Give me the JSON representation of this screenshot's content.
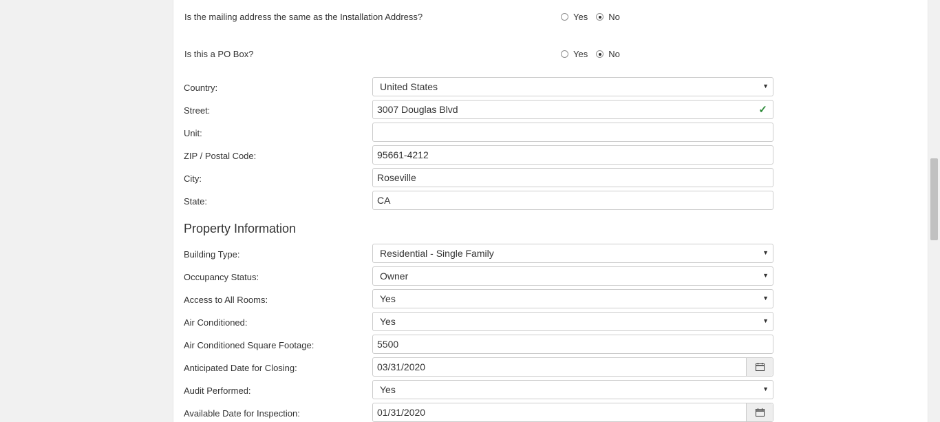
{
  "questions": [
    {
      "text": "Is the mailing address the same as the Installation Address?",
      "yes": "Yes",
      "no": "No",
      "selected": "No"
    },
    {
      "text": "Is this a PO Box?",
      "yes": "Yes",
      "no": "No",
      "selected": "No"
    }
  ],
  "mailing": {
    "country_label": "Country:",
    "country_value": "United States",
    "street_label": "Street:",
    "street_value": "3007 Douglas Blvd",
    "unit_label": "Unit:",
    "unit_value": "",
    "zip_label": "ZIP / Postal Code:",
    "zip_value": "95661-4212",
    "city_label": "City:",
    "city_value": "Roseville",
    "state_label": "State:",
    "state_value": "CA"
  },
  "property": {
    "title": "Property Information",
    "building_type_label": "Building Type:",
    "building_type_value": "Residential - Single Family",
    "occupancy_label": "Occupancy Status:",
    "occupancy_value": "Owner",
    "access_label": "Access to All Rooms:",
    "access_value": "Yes",
    "ac_label": "Air Conditioned:",
    "ac_value": "Yes",
    "ac_sqft_label": "Air Conditioned Square Footage:",
    "ac_sqft_value": "5500",
    "closing_label": "Anticipated Date for Closing:",
    "closing_value": "03/31/2020",
    "audit_label": "Audit Performed:",
    "audit_value": "Yes",
    "inspection_label": "Available Date for Inspection:",
    "inspection_value": "01/31/2020"
  },
  "icons": {
    "valid": "checkmark-icon",
    "calendar": "calendar-icon",
    "dropdown": "caret-down-icon"
  },
  "colors": {
    "valid": "#2e8b3a",
    "border": "#cccccc"
  }
}
